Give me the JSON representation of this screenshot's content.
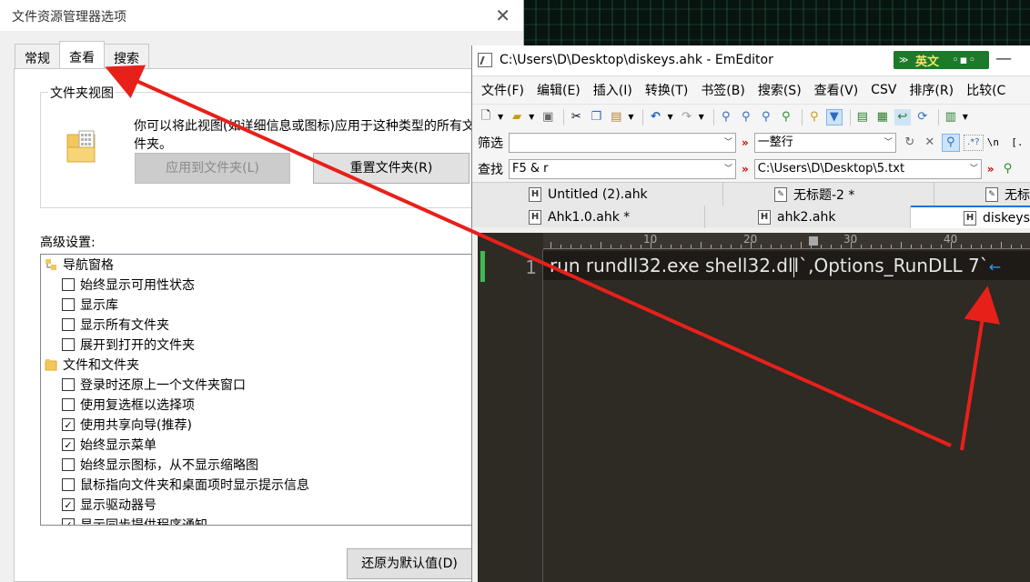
{
  "folder_options": {
    "title": "文件资源管理器选项",
    "tabs": [
      {
        "label": "常规"
      },
      {
        "label": "查看"
      },
      {
        "label": "搜索"
      }
    ],
    "folder_views": {
      "group_label": "文件夹视图",
      "description": "你可以将此视图(如详细信息或图标)应用于这种类型的所有文件夹。",
      "apply_button": "应用到文件夹(L)",
      "reset_button": "重置文件夹(R)"
    },
    "advanced_label": "高级设置:",
    "advanced_items": [
      {
        "type": "category",
        "label": "导航窗格"
      },
      {
        "type": "checkbox",
        "label": "始终显示可用性状态",
        "checked": false
      },
      {
        "type": "checkbox",
        "label": "显示库",
        "checked": false
      },
      {
        "type": "checkbox",
        "label": "显示所有文件夹",
        "checked": false
      },
      {
        "type": "checkbox",
        "label": "展开到打开的文件夹",
        "checked": false
      },
      {
        "type": "category",
        "label": "文件和文件夹"
      },
      {
        "type": "checkbox",
        "label": "登录时还原上一个文件夹窗口",
        "checked": false
      },
      {
        "type": "checkbox",
        "label": "使用复选框以选择项",
        "checked": false
      },
      {
        "type": "checkbox",
        "label": "使用共享向导(推荐)",
        "checked": true
      },
      {
        "type": "checkbox",
        "label": "始终显示菜单",
        "checked": true
      },
      {
        "type": "checkbox",
        "label": "始终显示图标，从不显示缩略图",
        "checked": false
      },
      {
        "type": "checkbox",
        "label": "鼠标指向文件夹和桌面项时显示提示信息",
        "checked": false
      },
      {
        "type": "checkbox",
        "label": "显示驱动器号",
        "checked": true
      },
      {
        "type": "checkbox",
        "label": "显示同步提供程序通知",
        "checked": true
      }
    ],
    "restore_defaults_button": "还原为默认值(D)"
  },
  "emeditor": {
    "title": "C:\\Users\\D\\Desktop\\diskeys.ahk - EmEditor",
    "ime_label": "英文",
    "menu": [
      "文件(F)",
      "编辑(E)",
      "插入(I)",
      "转换(T)",
      "书签(B)",
      "搜索(S)",
      "查看(V)",
      "CSV",
      "排序(R)",
      "比较(C"
    ],
    "filter_label": "筛选",
    "filter_value": "",
    "filter_mode": "一整行",
    "filter_tail": "\\n  [.",
    "find_label": "查找",
    "find_value": "F5 & r",
    "find_path": "C:\\Users\\D\\Desktop\\5.txt",
    "file_tabs": [
      {
        "label": "Untitled (2).ahk",
        "icon": "H"
      },
      {
        "label": "无标题-2 *",
        "icon": "doc"
      },
      {
        "label": "无标",
        "icon": "doc"
      },
      {
        "label": "Ahk1.0.ahk *",
        "icon": "H"
      },
      {
        "label": "ahk2.ahk",
        "icon": "H"
      },
      {
        "label": "diskeys",
        "icon": "H",
        "active": true
      }
    ],
    "ruler_numbers": [
      "10",
      "20",
      "30",
      "40"
    ],
    "line_number": "1",
    "code_before_cursor": "run rundll32.exe shell32.dl",
    "code_after_cursor": "l`,Options_RunDLL 7`",
    "eol_mark": "←"
  },
  "colors": {
    "annotation_arrow": "#e8201a",
    "editor_bg": "#2e2a24",
    "ime_bg": "#1c7a2a",
    "line_mark": "#3fb950"
  }
}
